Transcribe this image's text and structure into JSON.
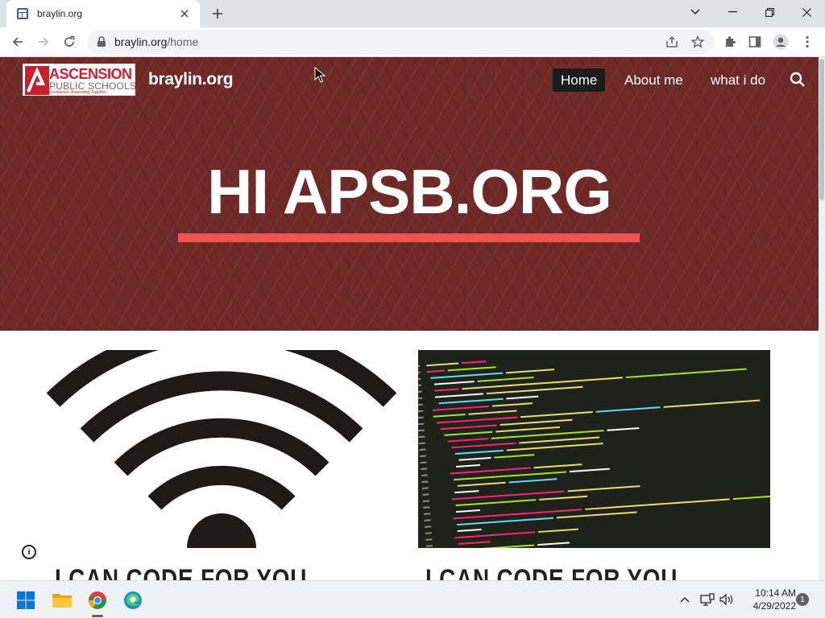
{
  "browser": {
    "tab_title": "braylin.org",
    "url_host": "braylin.org",
    "url_path": "/home"
  },
  "site": {
    "logo_word1": "ASCENSION",
    "logo_word2": "PUBLIC SCHOOLS",
    "logo_tag": "Excellence. Ascending Together.",
    "title": "braylin.org",
    "nav": [
      "Home",
      "About me",
      "what i do"
    ],
    "hero_title": "HI APSB.ORG",
    "card_titles": [
      "I CAN CODE FOR YOU",
      "I CAN CODE FOR YOU"
    ],
    "accent_color": "#f0534f",
    "hero_color": "#6f2a28"
  },
  "taskbar": {
    "time": "10:14 AM",
    "date": "4/29/2022",
    "notifications": "1"
  }
}
